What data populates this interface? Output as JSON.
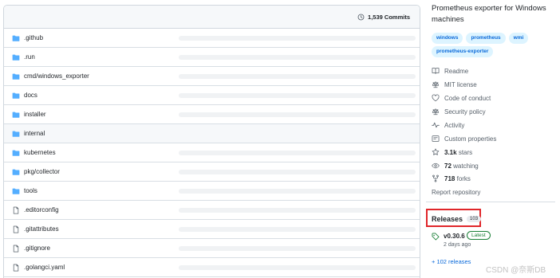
{
  "header": {
    "commits_label": "1,539 Commits"
  },
  "files": [
    {
      "name": ".github",
      "type": "folder"
    },
    {
      "name": ".run",
      "type": "folder"
    },
    {
      "name": "cmd/windows_exporter",
      "type": "folder"
    },
    {
      "name": "docs",
      "type": "folder"
    },
    {
      "name": "installer",
      "type": "folder"
    },
    {
      "name": "internal",
      "type": "folder"
    },
    {
      "name": "kubernetes",
      "type": "folder"
    },
    {
      "name": "pkg/collector",
      "type": "folder"
    },
    {
      "name": "tools",
      "type": "folder"
    },
    {
      "name": ".editorconfig",
      "type": "file"
    },
    {
      "name": ".gitattributes",
      "type": "file"
    },
    {
      "name": ".gitignore",
      "type": "file"
    },
    {
      "name": ".golangci.yaml",
      "type": "file"
    }
  ],
  "about": {
    "description": "Prometheus exporter for Windows machines",
    "topics": [
      "windows",
      "prometheus",
      "wmi",
      "prometheus-exporter"
    ]
  },
  "meta": {
    "readme": "Readme",
    "license": "MIT license",
    "conduct": "Code of conduct",
    "security": "Security policy",
    "activity": "Activity",
    "custom": "Custom properties",
    "stars_count": "3.1k",
    "stars_label": "stars",
    "watching_count": "72",
    "watching_label": "watching",
    "forks_count": "718",
    "forks_label": "forks",
    "report": "Report repository"
  },
  "releases": {
    "title": "Releases",
    "count": "103",
    "version": "v0.30.6",
    "latest_label": "Latest",
    "date": "2 days ago",
    "more": "+ 102 releases"
  },
  "watermark": "CSDN @奈斯DB",
  "colors": {
    "folder": "#54aeff",
    "link": "#0969da",
    "highlight_box": "#e0262a",
    "latest": "#1a7f37"
  }
}
